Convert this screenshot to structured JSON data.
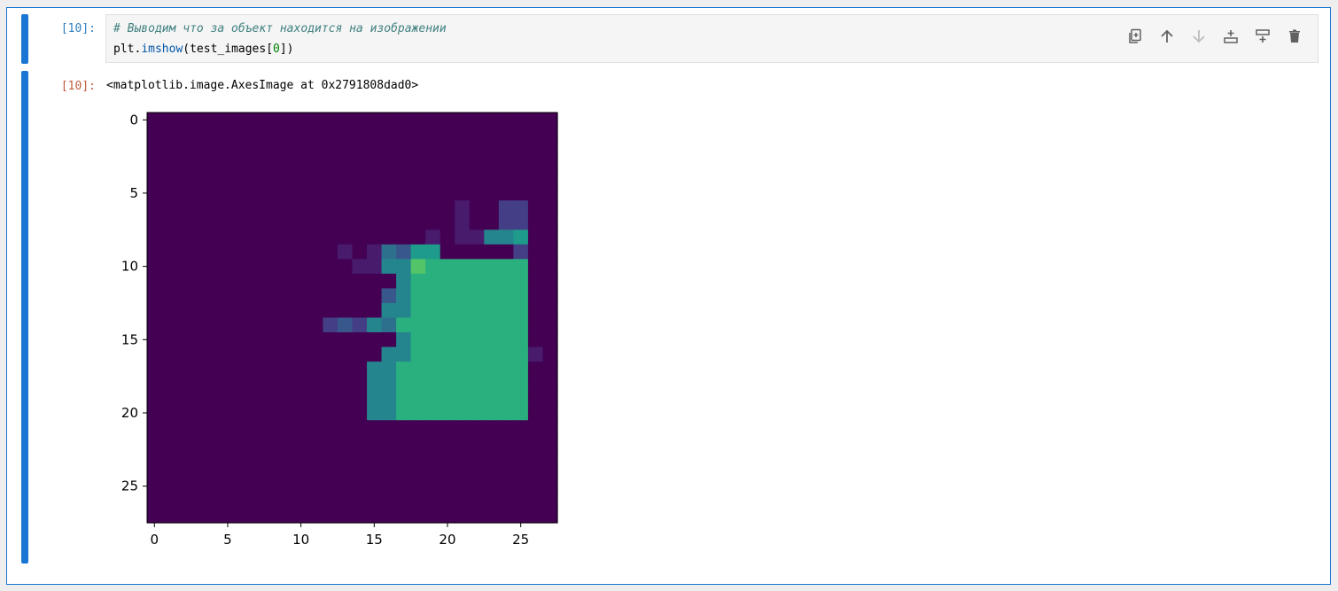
{
  "colors": {
    "accent": "#1976d2",
    "prompt_in": "#307fc1",
    "prompt_out": "#bf5b3d",
    "comment": "#408080",
    "function": "#0055aa",
    "number": "#008000"
  },
  "cell": {
    "in_prompt": "[10]:",
    "out_prompt": "[10]:",
    "code": {
      "comment": "# Выводим что за объект находится на изображении",
      "line2_pre": "plt.",
      "line2_fn": "imshow",
      "line2_mid": "(test_images[",
      "line2_num": "0",
      "line2_post": "])"
    },
    "output_text": "<matplotlib.image.AxesImage at 0x2791808dad0>"
  },
  "toolbar": {
    "icons": [
      {
        "name": "duplicate-icon",
        "label": "Duplicate"
      },
      {
        "name": "move-up-icon",
        "label": "Move up"
      },
      {
        "name": "move-down-icon",
        "label": "Move down"
      },
      {
        "name": "insert-above-icon",
        "label": "Insert above"
      },
      {
        "name": "insert-below-icon",
        "label": "Insert below"
      },
      {
        "name": "delete-icon",
        "label": "Delete"
      }
    ]
  },
  "chart_data": {
    "type": "heatmap",
    "colormap": "viridis",
    "value_range": [
      0,
      1
    ],
    "x_ticks": [
      0,
      5,
      10,
      15,
      20,
      25
    ],
    "y_ticks": [
      0,
      5,
      10,
      15,
      20,
      25
    ],
    "x_tick_labels": [
      "0",
      "5",
      "10",
      "15",
      "20",
      "25"
    ],
    "y_tick_labels": [
      "0",
      "5",
      "10",
      "15",
      "20",
      "25"
    ],
    "xlim": [
      -0.5,
      27.5
    ],
    "ylim": [
      27.5,
      -0.5
    ],
    "grid": false,
    "rows": [
      "0000000000000000000000000000",
      "0000000000000000000000000000",
      "0000000000000000000000000000",
      "0000000000000000000000000000",
      "0000000000000000000000000000",
      "0000000000000000000000000000",
      "0000000000000000000001002200",
      "0000000000000000000001002200",
      "0000000000000000000101155600",
      "0000000000000101436600000200",
      "0000000000000011558777777700",
      "0000000000000000057777777700",
      "0000000000000000357777777700",
      "0000000000000000557777777700",
      "0000000000002325477777777700",
      "0000000000000000057777777700",
      "0000000000000000557777777710",
      "0000000000000005577777777700",
      "0000000000000005577777777700",
      "0000000000000005577777777700",
      "0000000000000005577777777700",
      "0000000000000000000000000000",
      "0000000000000000000000000000",
      "0000000000000000000000000000",
      "0000000000000000000000000000",
      "0000000000000000000000000000",
      "0000000000000000000000000000",
      "0000000000000000000000000000"
    ]
  }
}
